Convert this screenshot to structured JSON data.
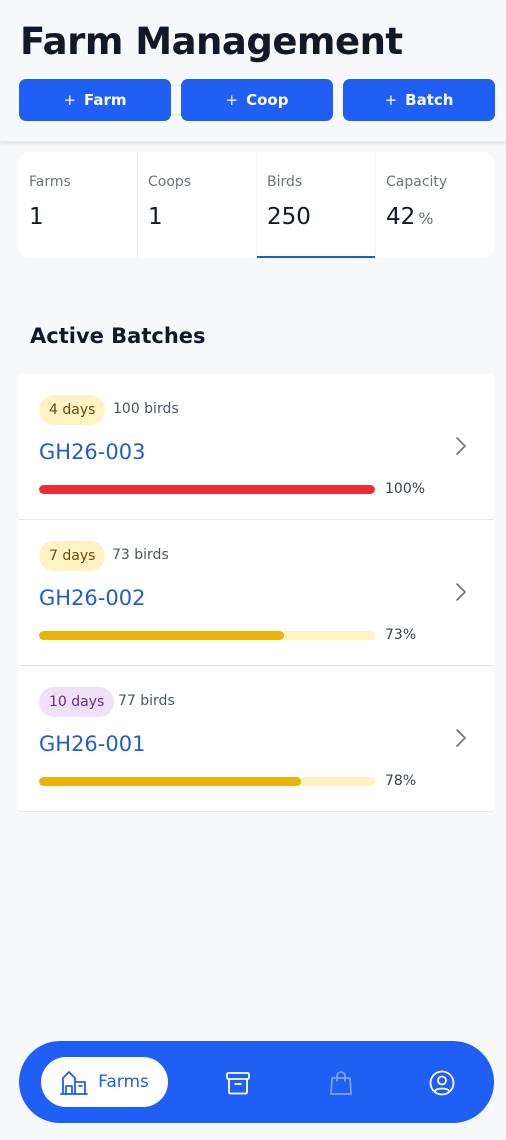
{
  "header": {
    "title": "Farm Management",
    "actions": [
      {
        "label": "Farm"
      },
      {
        "label": "Coop"
      },
      {
        "label": "Batch"
      }
    ]
  },
  "stats": [
    {
      "label": "Farms",
      "value": "1"
    },
    {
      "label": "Coops",
      "value": "1"
    },
    {
      "label": "Birds",
      "value": "250"
    },
    {
      "label": "Capacity",
      "value": "42",
      "unit": "%"
    }
  ],
  "active_batches": {
    "title": "Active Batches",
    "items": [
      {
        "age": "4 days",
        "birds": "100 birds",
        "code": "GH26-003",
        "progress_label": "100%",
        "progress": 1.0,
        "bar_color": "#ef2b34",
        "badge_style": "yellow"
      },
      {
        "age": "7 days",
        "birds": "73 birds",
        "code": "GH26-002",
        "progress_label": "73%",
        "progress": 0.73,
        "bar_color": "#eab308",
        "badge_style": "yellow"
      },
      {
        "age": "10 days",
        "birds": "77 birds",
        "code": "GH26-001",
        "progress_label": "78%",
        "progress": 0.78,
        "bar_color": "#eab308",
        "badge_style": "purple"
      }
    ]
  },
  "nav": {
    "active_label": "Farms",
    "icons": [
      "farm-icon",
      "archive-box-icon",
      "shopping-bag-icon",
      "user-circle-icon"
    ]
  },
  "colors": {
    "primary": "#1f5ff5",
    "link": "#1f5fc8",
    "danger": "#ef2b34",
    "warning": "#eab308"
  }
}
